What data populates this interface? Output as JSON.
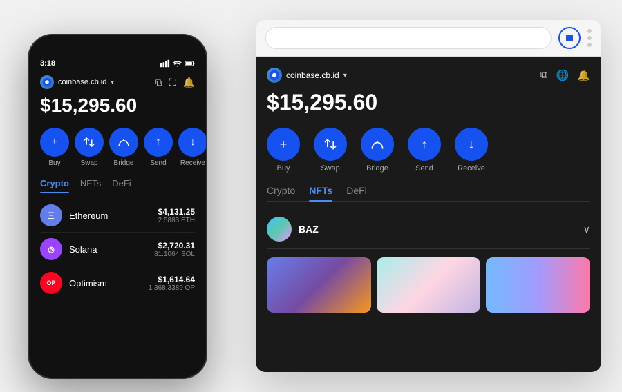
{
  "phone": {
    "status_time": "3:18",
    "account_name": "coinbase.cb.id",
    "balance": "$15,295.60",
    "actions": [
      {
        "label": "Buy",
        "icon": "+"
      },
      {
        "label": "Swap",
        "icon": "⇄"
      },
      {
        "label": "Bridge",
        "icon": "⌀"
      },
      {
        "label": "Send",
        "icon": "↑"
      },
      {
        "label": "Receive",
        "icon": "↓"
      }
    ],
    "tabs": [
      "Crypto",
      "NFTs",
      "DeFi"
    ],
    "active_tab": "Crypto",
    "assets": [
      {
        "name": "Ethereum",
        "usd": "$4,131.25",
        "amount": "2.5883 ETH",
        "type": "eth",
        "icon": "Ξ"
      },
      {
        "name": "Solana",
        "usd": "$2,720.31",
        "amount": "81.1064 SOL",
        "type": "sol",
        "icon": "◎"
      },
      {
        "name": "Optimism",
        "usd": "$1,614.64",
        "amount": "1,368.3389 OP",
        "type": "op",
        "icon": "OP"
      }
    ]
  },
  "browser": {
    "url": "",
    "account_name": "coinbase.cb.id",
    "balance": "$15,295.60",
    "actions": [
      {
        "label": "Buy",
        "icon": "+"
      },
      {
        "label": "Swap",
        "icon": "⇄"
      },
      {
        "label": "Bridge",
        "icon": "⌀"
      },
      {
        "label": "Send",
        "icon": "↑"
      },
      {
        "label": "Receive",
        "icon": "↓"
      }
    ],
    "tabs": [
      "Crypto",
      "NFTs",
      "DeFi"
    ],
    "active_tab": "NFTs",
    "nft_collection_name": "BAZ",
    "chevron": "∨"
  }
}
